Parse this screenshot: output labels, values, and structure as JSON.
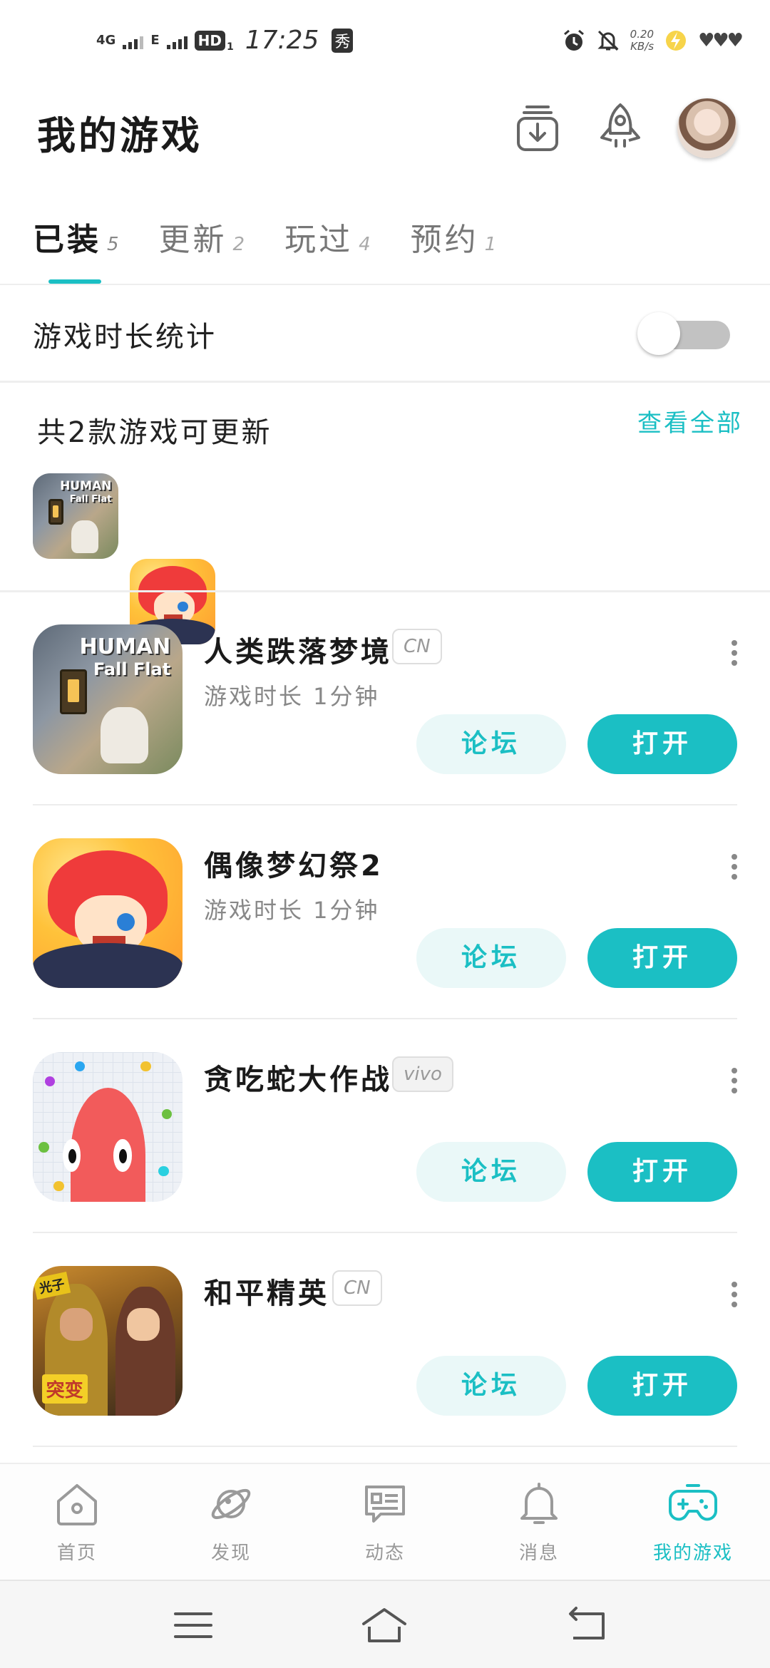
{
  "status_bar": {
    "network_1": "4G",
    "network_2": "E",
    "hd": "HD",
    "sim": "1",
    "time": "17:25",
    "xiu": "秀",
    "speed_value": "0.20",
    "speed_unit": "KB/s"
  },
  "header": {
    "title": "我的游戏"
  },
  "tabs": [
    {
      "label": "已装",
      "count": "5",
      "active": true
    },
    {
      "label": "更新",
      "count": "2",
      "active": false
    },
    {
      "label": "玩过",
      "count": "4",
      "active": false
    },
    {
      "label": "预约",
      "count": "1",
      "active": false
    }
  ],
  "stats": {
    "label": "游戏时长统计",
    "enabled": false
  },
  "updates": {
    "title": "共2款游戏可更新",
    "view_all": "查看全部"
  },
  "games": [
    {
      "name": "人类跌落梦境",
      "tag": "CN",
      "playtime": "游戏时长 1分钟",
      "forum": "论坛",
      "open": "打开"
    },
    {
      "name": "偶像梦幻祭2",
      "tag": "",
      "playtime": "游戏时长 1分钟",
      "forum": "论坛",
      "open": "打开"
    },
    {
      "name": "贪吃蛇大作战",
      "tag": "vivo",
      "playtime": "",
      "forum": "论坛",
      "open": "打开"
    },
    {
      "name": "和平精英",
      "tag": "CN",
      "playtime": "",
      "forum": "论坛",
      "open": "打开"
    }
  ],
  "icon_text": {
    "human_line1": "HUMAN",
    "human_line2": "Fall Flat",
    "pubg_tag": "光子",
    "pubg_banner": "突变"
  },
  "bottom_nav": [
    {
      "label": "首页",
      "icon": "home-icon",
      "active": false
    },
    {
      "label": "发现",
      "icon": "planet-icon",
      "active": false
    },
    {
      "label": "动态",
      "icon": "message-card-icon",
      "active": false
    },
    {
      "label": "消息",
      "icon": "bell-icon",
      "active": false
    },
    {
      "label": "我的游戏",
      "icon": "gamepad-icon",
      "active": true
    }
  ],
  "colors": {
    "accent": "#1bbfc4",
    "forum_bg": "#eaf8f8",
    "toggle_off": "#c2c2c2"
  }
}
